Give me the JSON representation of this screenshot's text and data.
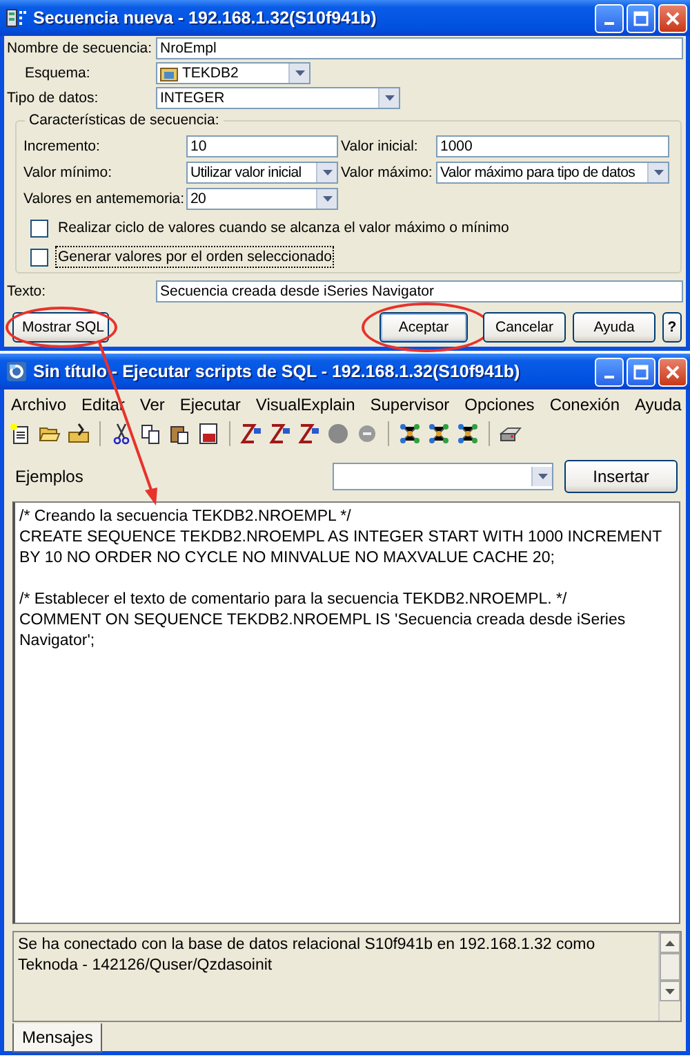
{
  "dialog": {
    "title": "Secuencia nueva - 192.168.1.32(S10f941b)",
    "name_field": {
      "label": "Nombre de secuencia:",
      "value": "NroEmpl"
    },
    "schema_field": {
      "label": "Esquema:",
      "value": "TEKDB2"
    },
    "type_field": {
      "label": "Tipo de datos:",
      "value": "INTEGER"
    },
    "group": {
      "title": "Características de secuencia:",
      "fields": [
        {
          "label": "Incremento:",
          "value": "10",
          "kind": "text"
        },
        {
          "label": "Valor inicial:",
          "value": "1000",
          "kind": "text"
        },
        {
          "label": "Valor mínimo:",
          "value": "Utilizar valor inicial",
          "kind": "dropdown"
        },
        {
          "label": "Valor máximo:",
          "value": "Valor máximo para tipo de datos",
          "kind": "dropdown"
        },
        {
          "label": "Valores en antememoria:",
          "value": "20",
          "kind": "dropdown"
        }
      ],
      "checkboxes": [
        {
          "label": "Realizar ciclo de valores cuando se alcanza el valor máximo o mínimo",
          "checked": false,
          "focused": false
        },
        {
          "label": "Generar valores por el orden seleccionado",
          "checked": false,
          "focused": true
        }
      ]
    },
    "text_field": {
      "label": "Texto:",
      "value": "Secuencia creada desde iSeries Navigator"
    },
    "left_button": "Mostrar SQL",
    "buttons": [
      {
        "label": "Aceptar",
        "kind": "default"
      },
      {
        "label": "Cancelar",
        "kind": "normal"
      },
      {
        "label": "Ayuda",
        "kind": "normal"
      },
      {
        "label": "?",
        "kind": "small"
      }
    ]
  },
  "sql_window": {
    "title": "Sin título - Ejecutar scripts de SQL - 192.168.1.32(S10f941b)",
    "menu": [
      "Archivo",
      "Editar",
      "Ver",
      "Ejecutar",
      "VisualExplain",
      "Supervisor",
      "Opciones",
      "Conexión",
      "Ayuda"
    ],
    "examples": {
      "label": "Ejemplos",
      "button": "Insertar"
    },
    "script": [
      {
        "comment": "/* Creando la secuencia TEKDB2.NROEMPL */",
        "statement": "CREATE SEQUENCE TEKDB2.NROEMPL AS INTEGER START WITH 1000 INCREMENT BY 10 NO ORDER NO CYCLE NO MINVALUE NO MAXVALUE CACHE 20;"
      },
      {
        "comment": "/* Establecer el texto de comentario para la secuencia TEKDB2.NROEMPL. */",
        "statement": "COMMENT ON SEQUENCE TEKDB2.NROEMPL IS 'Secuencia creada desde iSeries Navigator';"
      }
    ],
    "message": "Se ha conectado con la base de datos relacional S10f941b en 192.168.1.32 como Teknoda - 142126/Quser/Qzdasoinit",
    "tabs": [
      {
        "label": "Mensajes",
        "selected": true
      }
    ]
  }
}
